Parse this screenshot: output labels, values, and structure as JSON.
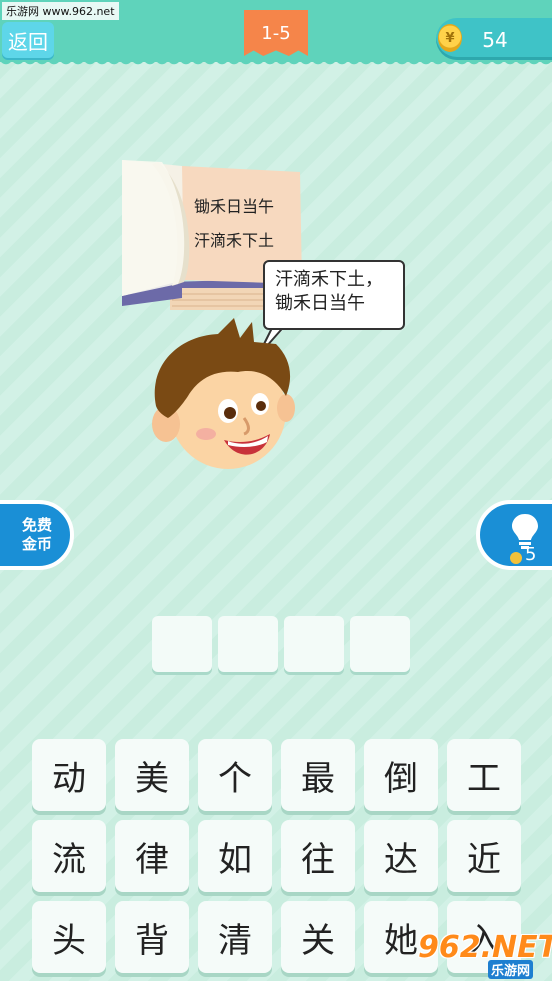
{
  "watermark_top": "乐游网 www.962.net",
  "header": {
    "back_label": "返回",
    "level": "1-5",
    "coins": "54",
    "coin_glyph": "¥"
  },
  "scene": {
    "book_lines": [
      "锄禾日当午",
      "汗滴禾下土"
    ],
    "bubble_lines": [
      "汗滴禾下土，",
      "锄禾日当午"
    ]
  },
  "side": {
    "free_coins_line1": "免费",
    "free_coins_line2": "金币",
    "hint_count": "5"
  },
  "answer_slots": [
    "",
    "",
    "",
    ""
  ],
  "keyboard": [
    [
      "动",
      "美",
      "个",
      "最",
      "倒",
      "工"
    ],
    [
      "流",
      "律",
      "如",
      "往",
      "达",
      "近"
    ],
    [
      "头",
      "背",
      "清",
      "关",
      "她",
      "入"
    ]
  ],
  "watermark_bottom": {
    "logo": "962.NET",
    "sub": "乐游网"
  },
  "colors": {
    "header": "#5fd3bb",
    "level_badge": "#f5854a",
    "side_button": "#1a8fd6"
  }
}
